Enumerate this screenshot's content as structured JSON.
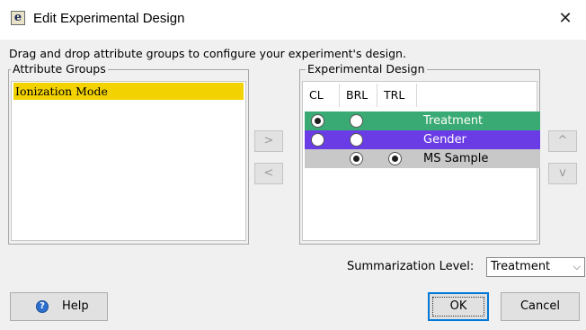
{
  "window": {
    "title": "Edit Experimental Design",
    "app_icon": "e-app-icon",
    "close_glyph": "✕"
  },
  "instruction": "Drag and drop attribute groups to configure your experiment's design.",
  "attribute_groups": {
    "legend": "Attribute Groups",
    "items": [
      "Ionization Mode"
    ],
    "selected_color": "#f2d200"
  },
  "experimental_design": {
    "legend": "Experimental Design",
    "columns": [
      "CL",
      "BRL",
      "TRL"
    ],
    "rows": [
      {
        "label": "Treatment",
        "color": "#3aaa74",
        "text_color": "#ffffff",
        "cl": "selected",
        "brl": "unselected",
        "trl": "none"
      },
      {
        "label": "Gender",
        "color": "#6a3ce6",
        "text_color": "#ffffff",
        "cl": "unselected",
        "brl": "unselected",
        "trl": "none"
      },
      {
        "label": "MS Sample",
        "color": "#c8c8c8",
        "text_color": "#000000",
        "cl": "none",
        "brl": "selected",
        "trl": "selected"
      }
    ]
  },
  "move_buttons": {
    "right": ">",
    "left": "<",
    "up": "^",
    "down": "v"
  },
  "summarization": {
    "label": "Summarization Level:",
    "value": "Treatment",
    "chevron": "⌵"
  },
  "buttons": {
    "help": "Help",
    "ok": "OK",
    "cancel": "Cancel"
  },
  "colors": {
    "accent": "#0078d7",
    "help_icon": "#2d6fce"
  }
}
